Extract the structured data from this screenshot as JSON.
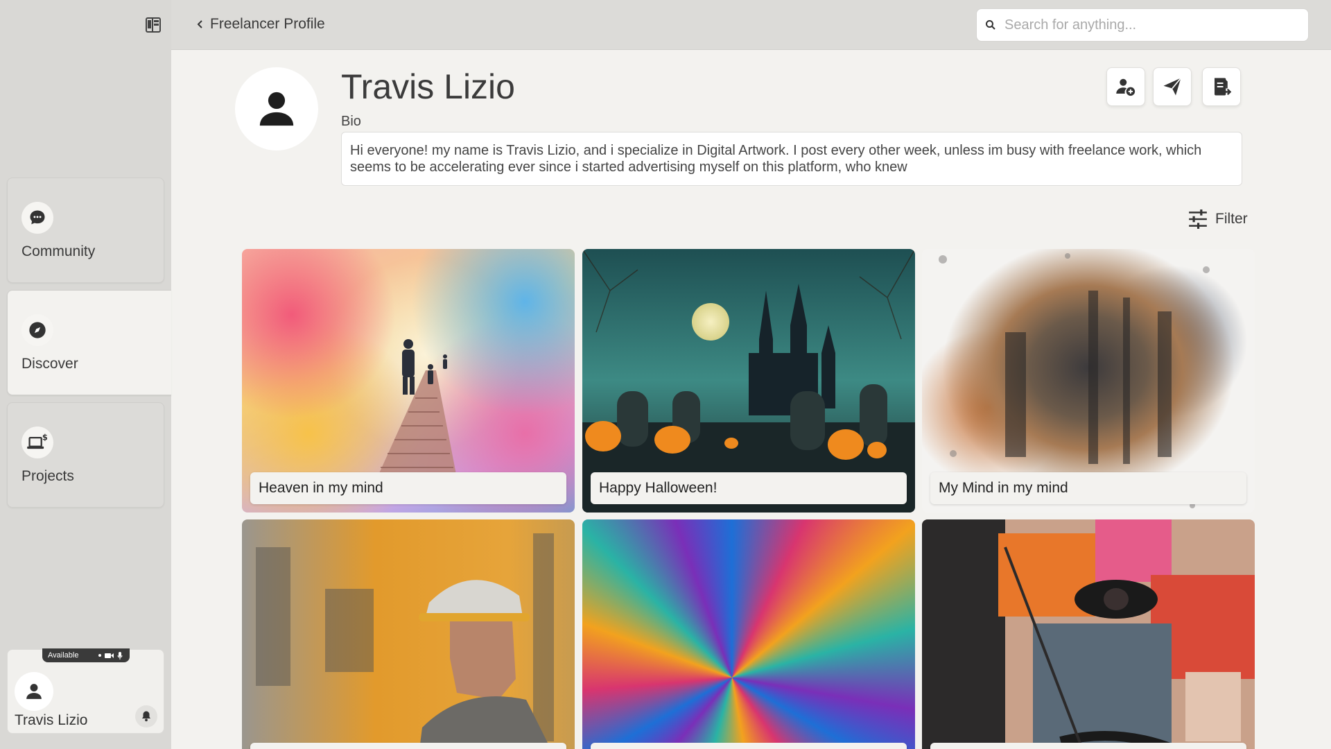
{
  "header": {
    "breadcrumb": "Freelancer Profile",
    "search_placeholder": "Search for anything..."
  },
  "sidebar": {
    "items": [
      {
        "label": "Community",
        "icon": "chat-bubble-icon"
      },
      {
        "label": "Discover",
        "icon": "compass-icon"
      },
      {
        "label": "Projects",
        "icon": "laptop-dollar-icon"
      }
    ],
    "user": {
      "name": "Travis Lizio",
      "status": "Available"
    }
  },
  "profile": {
    "name": "Travis Lizio",
    "bio_label": "Bio",
    "bio": "Hi everyone! my name is Travis Lizio, and i specialize in Digital Artwork. I post every other week, unless im busy with freelance work, which seems to be accelerating ever since i started advertising myself on this platform, who knew",
    "actions": [
      "add-contact-icon",
      "send-icon",
      "document-export-icon"
    ]
  },
  "filter": {
    "label": "Filter"
  },
  "gallery": [
    {
      "title": "Heaven in my mind"
    },
    {
      "title": "Happy Halloween!"
    },
    {
      "title": "My Mind in my mind"
    },
    {
      "title": ""
    },
    {
      "title": ""
    },
    {
      "title": ""
    }
  ],
  "colors": {
    "sidebar_bg": "#d9d8d5",
    "main_bg": "#f3f2ef",
    "header_bg": "#dcdbd8"
  }
}
